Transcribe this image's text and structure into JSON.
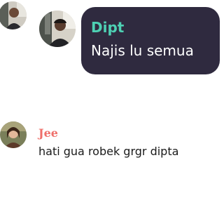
{
  "messages": [
    {
      "sender": "Dipt",
      "text": "Najis lu semua",
      "sender_color": "#4ed0b3",
      "bubble_color": "#2f2a3f",
      "text_color": "#ffffff",
      "avatar_icon": "avatar-photo"
    },
    {
      "sender": "Jee",
      "text": "hati gua robek grgr dipta",
      "sender_color": "#ef6f6a",
      "text_color": "#1a1a1a",
      "avatar_icon": "avatar-photo"
    }
  ],
  "previous_message": {
    "avatar_icon": "avatar-photo"
  }
}
